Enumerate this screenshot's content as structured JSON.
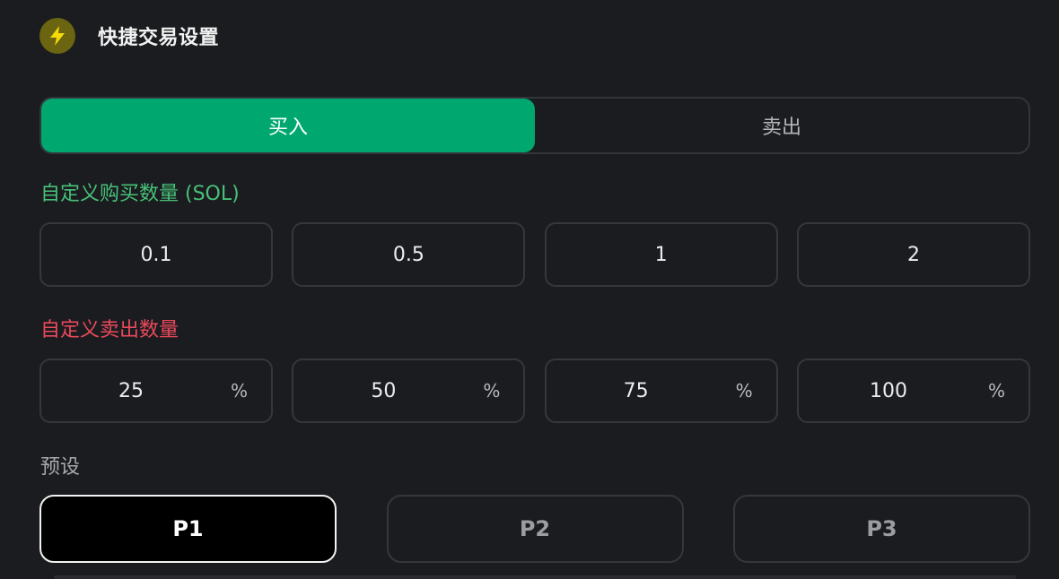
{
  "header": {
    "title": "快捷交易设置",
    "icon": "lightning-icon"
  },
  "colors": {
    "accent_green": "#00a86f",
    "buy_label": "#47c178",
    "sell_label": "#e94a5b",
    "icon_bg": "#6b6410",
    "icon_fg": "#f5d90a"
  },
  "tabs": [
    {
      "label": "买入",
      "active": true
    },
    {
      "label": "卖出",
      "active": false
    }
  ],
  "buy": {
    "label": "自定义购买数量 (SOL)",
    "amounts": [
      "0.1",
      "0.5",
      "1",
      "2"
    ]
  },
  "sell": {
    "label": "自定义卖出数量",
    "amounts": [
      "25",
      "50",
      "75",
      "100"
    ],
    "unit": "%"
  },
  "presets": {
    "label": "预设",
    "items": [
      {
        "label": "P1",
        "active": true
      },
      {
        "label": "P2",
        "active": false
      },
      {
        "label": "P3",
        "active": false
      }
    ]
  }
}
